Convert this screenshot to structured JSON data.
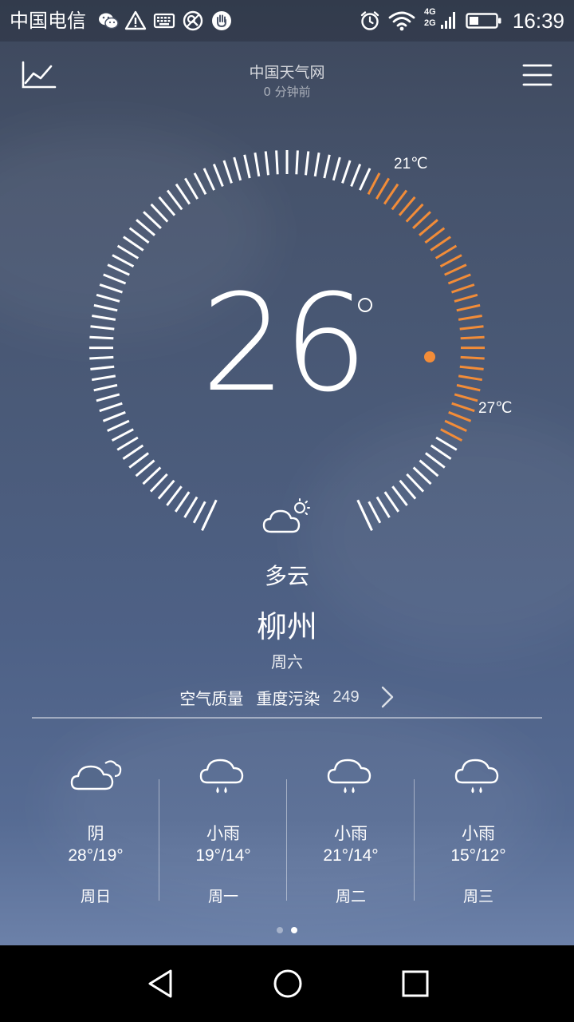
{
  "status_bar": {
    "carrier": "中国电信",
    "network_label_top": "4G",
    "network_label_bottom": "2G",
    "time": "16:39",
    "icons": [
      "wechat-icon",
      "warning-icon",
      "keyboard-icon",
      "no-signal-icon",
      "hand-icon",
      "alarm-icon",
      "wifi-icon",
      "cellular-signal-icon",
      "battery-icon"
    ]
  },
  "header": {
    "source": "中国天气网",
    "updated": "0 分钟前"
  },
  "gauge": {
    "current_temp": "26",
    "min_label": "21℃",
    "max_label": "27℃",
    "min_temp": 21,
    "max_temp": 27,
    "accent_color": "#f28c38"
  },
  "current": {
    "condition": "多云",
    "city": "柳州",
    "weekday": "周六",
    "icon": "partly-cloudy-icon"
  },
  "air_quality": {
    "label": "空气质量",
    "level": "重度污染",
    "value": "249"
  },
  "forecast": [
    {
      "condition": "阴",
      "temp": "28°/19°",
      "day": "周日",
      "icon": "overcast-icon"
    },
    {
      "condition": "小雨",
      "temp": "19°/14°",
      "day": "周一",
      "icon": "light-rain-icon"
    },
    {
      "condition": "小雨",
      "temp": "21°/14°",
      "day": "周二",
      "icon": "light-rain-icon"
    },
    {
      "condition": "小雨",
      "temp": "15°/12°",
      "day": "周三",
      "icon": "light-rain-icon"
    }
  ],
  "pager": {
    "count": 2,
    "active": 2
  },
  "nav": [
    "back-icon",
    "home-icon",
    "recents-icon"
  ]
}
